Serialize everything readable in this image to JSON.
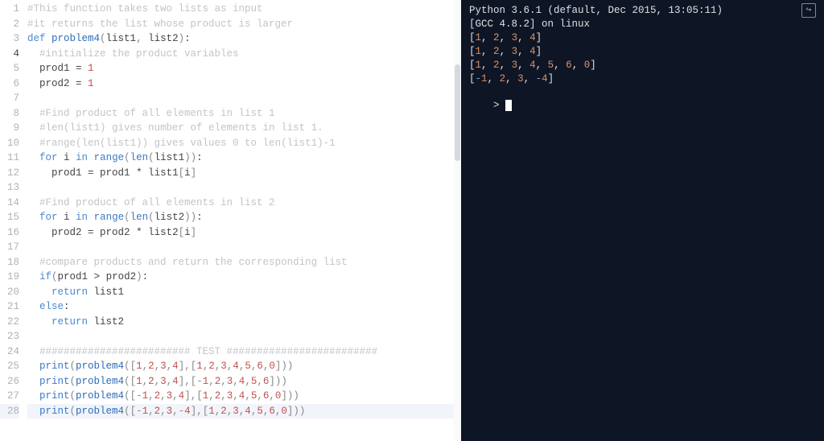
{
  "editor": {
    "lines": [
      {
        "num": 1,
        "indent": 0,
        "segs": [
          [
            "comment",
            "#This function takes two lists as input"
          ]
        ]
      },
      {
        "num": 2,
        "indent": 0,
        "segs": [
          [
            "comment",
            "#it returns the list whose product is larger"
          ]
        ]
      },
      {
        "num": 3,
        "indent": 0,
        "segs": [
          [
            "kw",
            "def "
          ],
          [
            "fn",
            "problem4"
          ],
          [
            "pun",
            "("
          ],
          [
            "var",
            "list1"
          ],
          [
            "pun",
            ", "
          ],
          [
            "var",
            "list2"
          ],
          [
            "pun",
            ")"
          ],
          [
            "op",
            ":"
          ]
        ]
      },
      {
        "num": 4,
        "indent": 1,
        "segs": [
          [
            "comment",
            "#initialize the product variables"
          ]
        ],
        "active": true
      },
      {
        "num": 5,
        "indent": 1,
        "segs": [
          [
            "var",
            "prod1"
          ],
          [
            "op",
            " = "
          ],
          [
            "num",
            "1"
          ]
        ]
      },
      {
        "num": 6,
        "indent": 1,
        "segs": [
          [
            "var",
            "prod2"
          ],
          [
            "op",
            " = "
          ],
          [
            "num",
            "1"
          ]
        ]
      },
      {
        "num": 7,
        "indent": 0,
        "segs": []
      },
      {
        "num": 8,
        "indent": 1,
        "segs": [
          [
            "comment",
            "#Find product of all elements in list 1"
          ]
        ]
      },
      {
        "num": 9,
        "indent": 1,
        "segs": [
          [
            "comment",
            "#len(list1) gives number of elements in list 1."
          ]
        ]
      },
      {
        "num": 10,
        "indent": 1,
        "segs": [
          [
            "comment",
            "#range(len(list1)) gives values 0 to len(list1)-1"
          ]
        ]
      },
      {
        "num": 11,
        "indent": 1,
        "segs": [
          [
            "kw",
            "for "
          ],
          [
            "var",
            "i"
          ],
          [
            "kw",
            " in "
          ],
          [
            "builtin",
            "range"
          ],
          [
            "pun",
            "("
          ],
          [
            "builtin",
            "len"
          ],
          [
            "pun",
            "("
          ],
          [
            "var",
            "list1"
          ],
          [
            "pun",
            ")"
          ],
          [
            "pun",
            ")"
          ],
          [
            "op",
            ":"
          ]
        ]
      },
      {
        "num": 12,
        "indent": 2,
        "segs": [
          [
            "var",
            "prod1"
          ],
          [
            "op",
            " = "
          ],
          [
            "var",
            "prod1"
          ],
          [
            "op",
            " * "
          ],
          [
            "var",
            "list1"
          ],
          [
            "pun",
            "["
          ],
          [
            "var",
            "i"
          ],
          [
            "pun",
            "]"
          ]
        ]
      },
      {
        "num": 13,
        "indent": 0,
        "segs": []
      },
      {
        "num": 14,
        "indent": 1,
        "segs": [
          [
            "comment",
            "#Find product of all elements in list 2"
          ]
        ]
      },
      {
        "num": 15,
        "indent": 1,
        "segs": [
          [
            "kw",
            "for "
          ],
          [
            "var",
            "i"
          ],
          [
            "kw",
            " in "
          ],
          [
            "builtin",
            "range"
          ],
          [
            "pun",
            "("
          ],
          [
            "builtin",
            "len"
          ],
          [
            "pun",
            "("
          ],
          [
            "var",
            "list2"
          ],
          [
            "pun",
            ")"
          ],
          [
            "pun",
            ")"
          ],
          [
            "op",
            ":"
          ]
        ]
      },
      {
        "num": 16,
        "indent": 2,
        "segs": [
          [
            "var",
            "prod2"
          ],
          [
            "op",
            " = "
          ],
          [
            "var",
            "prod2"
          ],
          [
            "op",
            " * "
          ],
          [
            "var",
            "list2"
          ],
          [
            "pun",
            "["
          ],
          [
            "var",
            "i"
          ],
          [
            "pun",
            "]"
          ]
        ]
      },
      {
        "num": 17,
        "indent": 0,
        "segs": []
      },
      {
        "num": 18,
        "indent": 1,
        "segs": [
          [
            "comment",
            "#compare products and return the corresponding list"
          ]
        ]
      },
      {
        "num": 19,
        "indent": 1,
        "segs": [
          [
            "kw",
            "if"
          ],
          [
            "pun",
            "("
          ],
          [
            "var",
            "prod1"
          ],
          [
            "op",
            " > "
          ],
          [
            "var",
            "prod2"
          ],
          [
            "pun",
            ")"
          ],
          [
            "op",
            ":"
          ]
        ]
      },
      {
        "num": 20,
        "indent": 2,
        "segs": [
          [
            "kw",
            "return "
          ],
          [
            "var",
            "list1"
          ]
        ]
      },
      {
        "num": 21,
        "indent": 1,
        "segs": [
          [
            "kw",
            "else"
          ],
          [
            "op",
            ":"
          ]
        ]
      },
      {
        "num": 22,
        "indent": 2,
        "segs": [
          [
            "kw",
            "return "
          ],
          [
            "var",
            "list2"
          ]
        ]
      },
      {
        "num": 23,
        "indent": 0,
        "segs": []
      },
      {
        "num": 24,
        "indent": 1,
        "segs": [
          [
            "comment",
            "######################### TEST #########################"
          ]
        ]
      },
      {
        "num": 25,
        "indent": 1,
        "segs": [
          [
            "builtin",
            "print"
          ],
          [
            "pun",
            "("
          ],
          [
            "fn",
            "problem4"
          ],
          [
            "pun",
            "(["
          ],
          [
            "num",
            "1"
          ],
          [
            "pun",
            ","
          ],
          [
            "num",
            "2"
          ],
          [
            "pun",
            ","
          ],
          [
            "num",
            "3"
          ],
          [
            "pun",
            ","
          ],
          [
            "num",
            "4"
          ],
          [
            "pun",
            "],["
          ],
          [
            "num",
            "1"
          ],
          [
            "pun",
            ","
          ],
          [
            "num",
            "2"
          ],
          [
            "pun",
            ","
          ],
          [
            "num",
            "3"
          ],
          [
            "pun",
            ","
          ],
          [
            "num",
            "4"
          ],
          [
            "pun",
            ","
          ],
          [
            "num",
            "5"
          ],
          [
            "pun",
            ","
          ],
          [
            "num",
            "6"
          ],
          [
            "pun",
            ","
          ],
          [
            "num",
            "0"
          ],
          [
            "pun",
            "]))"
          ]
        ]
      },
      {
        "num": 26,
        "indent": 1,
        "segs": [
          [
            "builtin",
            "print"
          ],
          [
            "pun",
            "("
          ],
          [
            "fn",
            "problem4"
          ],
          [
            "pun",
            "(["
          ],
          [
            "num",
            "1"
          ],
          [
            "pun",
            ","
          ],
          [
            "num",
            "2"
          ],
          [
            "pun",
            ","
          ],
          [
            "num",
            "3"
          ],
          [
            "pun",
            ","
          ],
          [
            "num",
            "4"
          ],
          [
            "pun",
            "],[-"
          ],
          [
            "num",
            "1"
          ],
          [
            "pun",
            ","
          ],
          [
            "num",
            "2"
          ],
          [
            "pun",
            ","
          ],
          [
            "num",
            "3"
          ],
          [
            "pun",
            ","
          ],
          [
            "num",
            "4"
          ],
          [
            "pun",
            ","
          ],
          [
            "num",
            "5"
          ],
          [
            "pun",
            ","
          ],
          [
            "num",
            "6"
          ],
          [
            "pun",
            "]))"
          ]
        ]
      },
      {
        "num": 27,
        "indent": 1,
        "segs": [
          [
            "builtin",
            "print"
          ],
          [
            "pun",
            "("
          ],
          [
            "fn",
            "problem4"
          ],
          [
            "pun",
            "([-"
          ],
          [
            "num",
            "1"
          ],
          [
            "pun",
            ","
          ],
          [
            "num",
            "2"
          ],
          [
            "pun",
            ","
          ],
          [
            "num",
            "3"
          ],
          [
            "pun",
            ","
          ],
          [
            "num",
            "4"
          ],
          [
            "pun",
            "],["
          ],
          [
            "num",
            "1"
          ],
          [
            "pun",
            ","
          ],
          [
            "num",
            "2"
          ],
          [
            "pun",
            ","
          ],
          [
            "num",
            "3"
          ],
          [
            "pun",
            ","
          ],
          [
            "num",
            "4"
          ],
          [
            "pun",
            ","
          ],
          [
            "num",
            "5"
          ],
          [
            "pun",
            ","
          ],
          [
            "num",
            "6"
          ],
          [
            "pun",
            ","
          ],
          [
            "num",
            "0"
          ],
          [
            "pun",
            "]))"
          ]
        ]
      },
      {
        "num": 28,
        "indent": 1,
        "segs": [
          [
            "builtin",
            "print"
          ],
          [
            "pun",
            "("
          ],
          [
            "fn",
            "problem4"
          ],
          [
            "pun",
            "([-"
          ],
          [
            "num",
            "1"
          ],
          [
            "pun",
            ","
          ],
          [
            "num",
            "2"
          ],
          [
            "pun",
            ","
          ],
          [
            "num",
            "3"
          ],
          [
            "pun",
            ",-"
          ],
          [
            "num",
            "4"
          ],
          [
            "pun",
            "],["
          ],
          [
            "num",
            "1"
          ],
          [
            "pun",
            ","
          ],
          [
            "num",
            "2"
          ],
          [
            "pun",
            ","
          ],
          [
            "num",
            "3"
          ],
          [
            "pun",
            ","
          ],
          [
            "num",
            "4"
          ],
          [
            "pun",
            ","
          ],
          [
            "num",
            "5"
          ],
          [
            "pun",
            ","
          ],
          [
            "num",
            "6"
          ],
          [
            "pun",
            ","
          ],
          [
            "num",
            "0"
          ],
          [
            "pun",
            "]))"
          ]
        ],
        "highlight": true
      }
    ]
  },
  "terminal": {
    "header": "Python 3.6.1 (default, Dec 2015, 13:05:11)",
    "subheader": "[GCC 4.8.2] on linux",
    "outputs": [
      "[1, 2, 3, 4]",
      "[1, 2, 3, 4]",
      "[1, 2, 3, 4, 5, 6, 0]",
      "[-1, 2, 3, -4]"
    ],
    "prompt": "> ",
    "popout_icon": "↪"
  }
}
